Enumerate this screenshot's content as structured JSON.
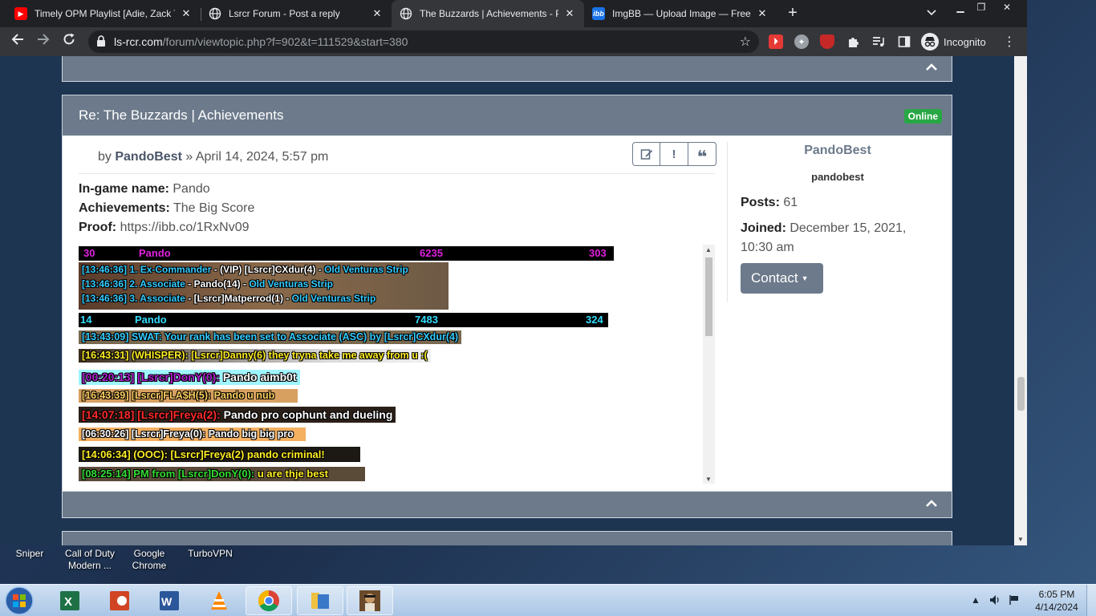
{
  "browser": {
    "tabs": [
      {
        "title": "Timely OPM Playlist [Adie, Zack Tabudlo...",
        "favicon": "youtube-icon",
        "color": "#ff0000"
      },
      {
        "title": "Lsrcr Forum - Post a reply",
        "favicon": "globe-icon",
        "color": "#e8eaed"
      },
      {
        "title": "The Buzzards | Achievements - Page",
        "favicon": "globe-icon",
        "color": "#e8eaed",
        "active": true
      },
      {
        "title": "ImgBB — Upload Image — Free Image",
        "favicon": "imgbb-icon",
        "favicon_text": "ibb",
        "color": "#1a73e8"
      }
    ],
    "url_host": "ls-rcr.com",
    "url_path": "/forum/viewtopic.php?f=902&t=111529&start=380",
    "incognito_label": "Incognito"
  },
  "post": {
    "title": "Re: The Buzzards | Achievements",
    "status_badge": "Online",
    "by_prefix": "by",
    "author": "PandoBest",
    "date_sep": "»",
    "date": "April 14, 2024, 5:57 pm",
    "fields": [
      {
        "label": "In-game name:",
        "value": "Pando"
      },
      {
        "label": "Achievements:",
        "value": "The Big Score"
      },
      {
        "label": "Proof:",
        "value": "https://ibb.co/1RxNv09"
      }
    ]
  },
  "proof": {
    "strip1": {
      "rank": "30",
      "name": "Pando",
      "score": "6235",
      "ping": "303"
    },
    "chat_block": [
      {
        "time": "[13:46:36]",
        "text": "1. Ex-Commander",
        "rest": " - (VIP)  [Lsrcr]CXdur(4) - ",
        "place": "Old Venturas Strip"
      },
      {
        "time": "[13:46:36]",
        "text": "2. Associate",
        "rest": " -  Pando(14) - ",
        "place": "Old Venturas Strip"
      },
      {
        "time": "[13:46:36]",
        "text": "3. Associate",
        "rest": " - [Lsrcr]Matperrod(1) - ",
        "place": "Old Venturas Strip"
      }
    ],
    "strip2": {
      "rank": "14",
      "name": "Pando",
      "score": "7483",
      "ping": "324"
    },
    "lines": [
      {
        "text": "[13:43:09] SWAT: Your rank has been set to Associate (ASC) by [Lsrcr]CXdur(4)"
      },
      {
        "text": "[16:43:31] (WHISPER): [Lsrcr]Danny(6) they tryna take me away from u :("
      },
      {
        "text_a": "[00:20:13] [Lsrcr]DonY(0): ",
        "text_b": "Pando aimb0t"
      },
      {
        "text": "[16:43:39] [Lsrcr]FLA$H(5): Pando u nub"
      },
      {
        "text_a": "[14:07:18] [Lsrcr]Freya(2): ",
        "text_b": "Pando pro cophunt and dueling"
      },
      {
        "text": "[06:30:26] [Lsrcr]Freya(0): Pando big big pro"
      },
      {
        "text": "[14:06:34] (OOC): [Lsrcr]Freya(2) pando criminal!"
      },
      {
        "text_a": "[08:25:14] PM from [Lsrcr]DonY(0): ",
        "text_b": "u are thje best"
      }
    ]
  },
  "profile": {
    "name": "PandoBest",
    "rank": "pandobest",
    "posts_label": "Posts:",
    "posts_value": "61",
    "joined_label": "Joined:",
    "joined_value": "December 15, 2021, 10:30 am",
    "contact_label": "Contact"
  },
  "desktop": {
    "icons": [
      {
        "label": "Sniper"
      },
      {
        "label_1": "Call of Duty",
        "label_2": "Modern ..."
      },
      {
        "label_1": "Google",
        "label_2": "Chrome"
      },
      {
        "label": "TurboVPN"
      }
    ]
  },
  "taskbar": {
    "time": "6:05 PM",
    "date": "4/14/2024"
  }
}
